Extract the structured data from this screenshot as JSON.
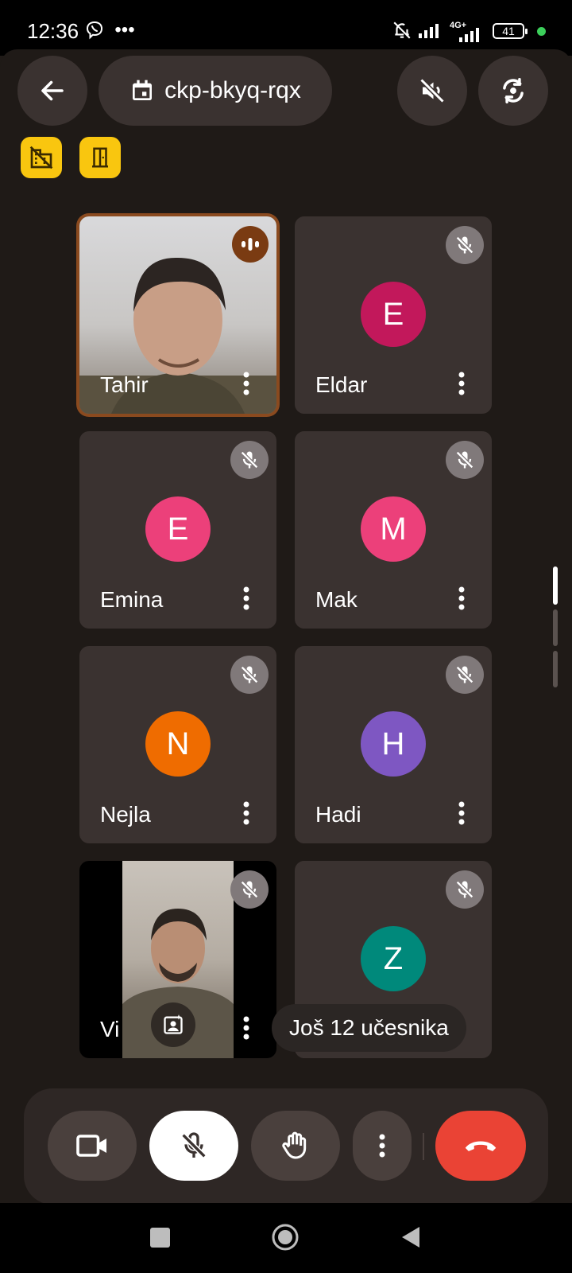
{
  "status_bar": {
    "time": "12:36",
    "icons": [
      "viber-icon",
      "more-notifications-icon",
      "bell-muted-icon",
      "signal-icon",
      "signal-4g-icon"
    ],
    "network_label": "4G+",
    "battery": "41"
  },
  "header": {
    "meeting_code": "ckp-bkyq-rqx",
    "icons": [
      "back-arrow-icon",
      "calendar-icon",
      "audio-off-icon",
      "switch-camera-icon"
    ]
  },
  "quick_actions": [
    "hide-building-icon",
    "door-icon"
  ],
  "participants": [
    {
      "name": "Tahir",
      "initial": "",
      "color": "",
      "video": true,
      "speaking": true
    },
    {
      "name": "Eldar",
      "initial": "E",
      "color": "#c2185b",
      "video": false,
      "muted": true
    },
    {
      "name": "Emina",
      "initial": "E",
      "color": "#ec407a",
      "video": false,
      "muted": true
    },
    {
      "name": "Mak",
      "initial": "M",
      "color": "#ec407a",
      "video": false,
      "muted": true
    },
    {
      "name": "Nejla",
      "initial": "N",
      "color": "#ef6c00",
      "video": false,
      "muted": true
    },
    {
      "name": "Hadi",
      "initial": "H",
      "color": "#7e57c2",
      "video": false,
      "muted": true
    },
    {
      "name": "Vi",
      "initial": "",
      "color": "",
      "video": true,
      "muted": true
    },
    {
      "name": "",
      "initial": "Z",
      "color": "#00897b",
      "video": false,
      "muted": true
    }
  ],
  "toast": "Još 12 učesnika",
  "controls": [
    "camera-icon",
    "mic-off-icon",
    "raise-hand-icon",
    "more-options-icon",
    "end-call-icon"
  ],
  "colors": {
    "accent_yellow": "#f9c60f",
    "end_call_red": "#ea4335",
    "speaking_border": "#8a4a1f"
  }
}
